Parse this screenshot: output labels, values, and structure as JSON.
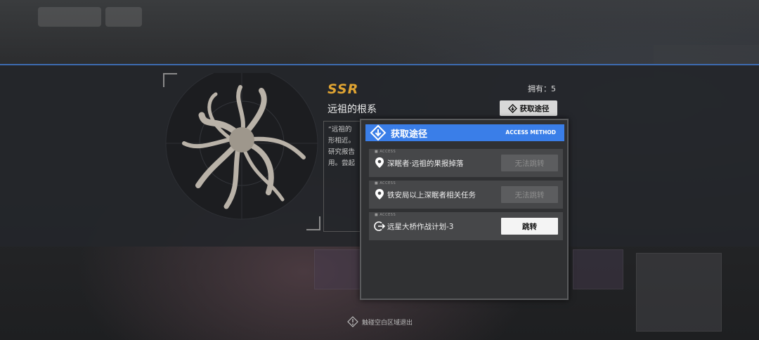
{
  "item": {
    "rarity": "SSR",
    "name": "远祖的根系",
    "owned_label": "拥有：5",
    "description_lines": [
      "“远祖的",
      "形相近。",
      "研究报告",
      "用。尝起"
    ],
    "get_method_button": "获取途径"
  },
  "popup": {
    "title": "获取途径",
    "subtitle": "ACCESS METHOD",
    "sources": [
      {
        "tag": "■ ACCESS",
        "label": "深眠者·远祖的果报掉落",
        "icon": "location-pin-icon",
        "button": "无法跳转",
        "enabled": false
      },
      {
        "tag": "■ ACCESS",
        "label": "铁安局以上深眠者相关任务",
        "icon": "location-pin-icon",
        "button": "无法跳转",
        "enabled": false
      },
      {
        "tag": "■ ACCESS",
        "label": "远星大桥作战计划-3",
        "icon": "exit-arrow-icon",
        "button": "跳转",
        "enabled": true
      }
    ]
  },
  "footer": {
    "exit_hint": "触碰空白区域退出"
  },
  "colors": {
    "accent": "#3a7ee8",
    "rarity": "#e0a432",
    "band_border": "#3d6bb0"
  }
}
